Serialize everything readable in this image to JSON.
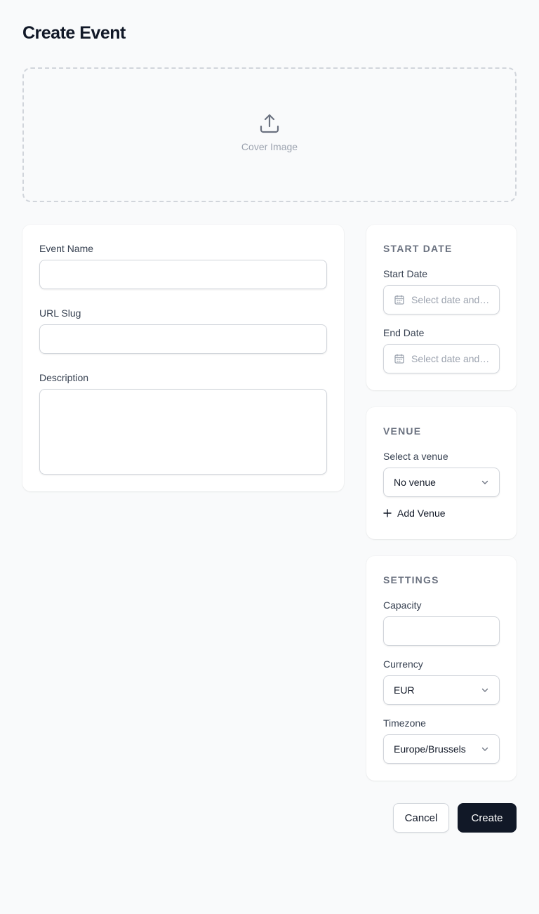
{
  "page": {
    "title": "Create Event"
  },
  "cover": {
    "label": "Cover Image",
    "icon": "upload-icon"
  },
  "details": {
    "name_label": "Event Name",
    "name_value": "",
    "slug_label": "URL Slug",
    "slug_value": "",
    "description_label": "Description",
    "description_value": ""
  },
  "dates": {
    "section_title": "START DATE",
    "start_label": "Start Date",
    "start_placeholder": "Select date and time",
    "end_label": "End Date",
    "end_placeholder": "Select date and time",
    "icon": "calendar-icon"
  },
  "venue": {
    "section_title": "VENUE",
    "select_label": "Select a venue",
    "selected": "No venue",
    "add_label": "Add Venue"
  },
  "settings": {
    "section_title": "SETTINGS",
    "capacity_label": "Capacity",
    "capacity_value": "",
    "currency_label": "Currency",
    "currency_selected": "EUR",
    "timezone_label": "Timezone",
    "timezone_selected": "Europe/Brussels"
  },
  "actions": {
    "cancel_label": "Cancel",
    "create_label": "Create"
  },
  "colors": {
    "primary": "#111827",
    "border": "#d1d5db",
    "muted": "#9ca3af",
    "background": "#f9fafb"
  }
}
